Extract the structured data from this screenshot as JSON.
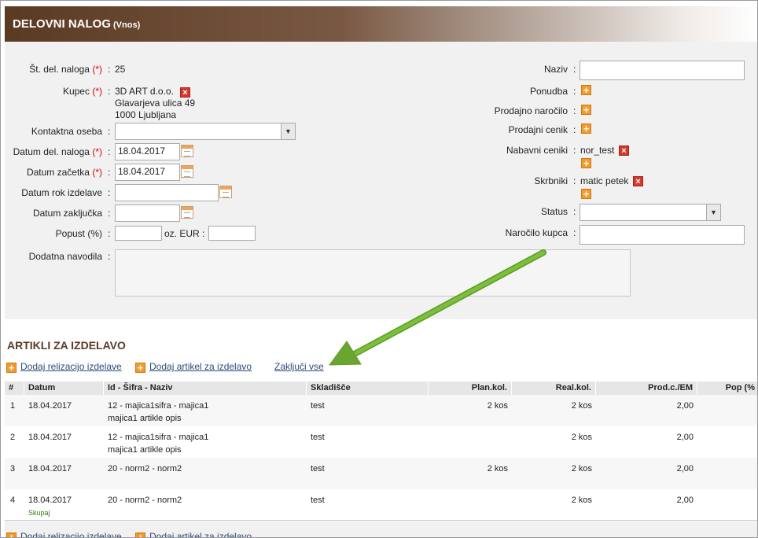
{
  "header": {
    "title": "DELOVNI NALOG",
    "subtitle": "(Vnos)"
  },
  "form": {
    "left": {
      "st_label": "Št. del. naloga",
      "req": "(*)",
      "st_value": "25",
      "kupec_label": "Kupec",
      "kupec_lines": [
        "3D ART d.o.o.",
        "Glavarjeva ulica 49",
        "1000 Ljubljana"
      ],
      "kontakt_label": "Kontaktna oseba",
      "kontakt_value": "",
      "datum_del_label": "Datum del. naloga",
      "datum_del_value": "18.04.2017",
      "datum_zac_label": "Datum začetka",
      "datum_zac_value": "18.04.2017",
      "datum_rok_label": "Datum rok izdelave",
      "datum_rok_value": "",
      "datum_zak_label": "Datum zaključka",
      "datum_zak_value": "",
      "popust_label": "Popust (%)",
      "popust_value": "",
      "oz_label": "oz. EUR",
      "eur_value": "",
      "navodila_label": "Dodatna navodila",
      "navodila_value": ""
    },
    "right": {
      "naziv_label": "Naziv",
      "naziv_value": "",
      "ponudba_label": "Ponudba",
      "narocilo_label": "Prodajno naročilo",
      "cenik_label": "Prodajni cenik",
      "nabavni_label": "Nabavni ceniki",
      "nabavni_value": "nor_test",
      "skrbniki_label": "Skrbniki",
      "skrbniki_value": "matic petek",
      "status_label": "Status",
      "status_value": "",
      "narocilo_kupca_label": "Naročilo kupca",
      "narocilo_kupca_value": ""
    },
    "colon": ":"
  },
  "section": {
    "title": "ARTIKLI ZA IZDELAVO",
    "actions": {
      "add_realization": "Dodaj relizacijo izdelave",
      "add_item": "Dodaj artikel za izdelavo",
      "close_all": "Zaključi vse"
    }
  },
  "table": {
    "headers": [
      "#",
      "Datum",
      "Id - Šifra - Naziv",
      "Skladišče",
      "Plan.kol.",
      "Real.kol.",
      "Prod.c./EM",
      "Pop (%"
    ],
    "rows": [
      {
        "no": "1",
        "datum": "18.04.2017",
        "naziv": "12 - majica1sifra - majica1",
        "opis": "majica1 artikle opis",
        "skladisce": "test",
        "plan": "2 kos",
        "real": "2 kos",
        "prod": "2,00"
      },
      {
        "no": "2",
        "datum": "18.04.2017",
        "naziv": "12 - majica1sifra - majica1",
        "opis": "majica1 artikle opis",
        "skladisce": "test",
        "plan": "",
        "real": "2 kos",
        "prod": "2,00"
      },
      {
        "no": "3",
        "datum": "18.04.2017",
        "naziv": "20 - norm2 - norm2",
        "opis": "",
        "skladisce": "test",
        "plan": "2 kos",
        "real": "2 kos",
        "prod": "2,00"
      },
      {
        "no": "4",
        "datum": "18.04.2017",
        "naziv": "20 - norm2 - norm2",
        "opis": "",
        "skladisce": "test",
        "plan": "",
        "real": "2 kos",
        "prod": "2,00"
      }
    ],
    "total_label": "Skupaj"
  },
  "colors": {
    "header_brown": "#5b3a23",
    "link": "#2e4a78",
    "arrow": "#6aa531",
    "required": "#dd0000"
  },
  "icons": {
    "remove": "remove-icon",
    "add": "add-icon",
    "calendar": "calendar-icon",
    "dropdown": "chevron-down-icon"
  }
}
